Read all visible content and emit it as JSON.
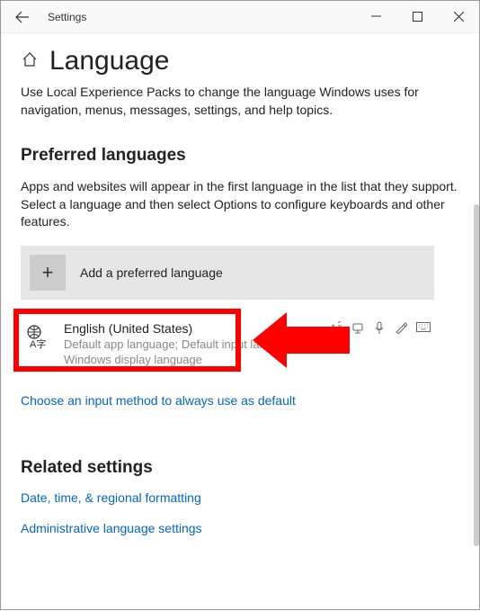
{
  "app": {
    "title": "Settings"
  },
  "page": {
    "title": "Language",
    "description": "Use Local Experience Packs to change the language Windows uses for navigation, menus, messages, settings, and help topics."
  },
  "preferred": {
    "heading": "Preferred languages",
    "description": "Apps and websites will appear in the first language in the list that they support. Select a language and then select Options to configure keyboards and other features.",
    "add_label": "Add a preferred language",
    "language": {
      "name": "English (United States)",
      "sub1": "Default app language; Default input language",
      "sub2": "Windows display language"
    }
  },
  "input_link": "Choose an input method to always use as default",
  "related": {
    "heading": "Related settings",
    "link1": "Date, time, & regional formatting",
    "link2": "Administrative language settings"
  }
}
